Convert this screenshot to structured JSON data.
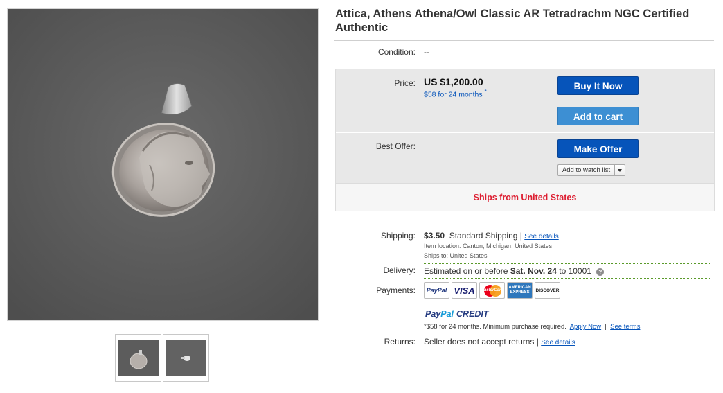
{
  "title": "Attica, Athens Athena/Owl Classic AR Tetradrachm NGC Certified Authentic",
  "condition": {
    "label": "Condition:",
    "value": "--"
  },
  "price": {
    "label": "Price:",
    "amount": "US $1,200.00",
    "financing": "$58 for 24 months",
    "financing_mark": "*"
  },
  "buttons": {
    "buy_now": "Buy It Now",
    "add_to_cart": "Add to cart",
    "make_offer": "Make Offer",
    "watch_list": "Add to watch list"
  },
  "best_offer": {
    "label": "Best Offer:"
  },
  "ships_from": "Ships from United States",
  "shipping": {
    "label": "Shipping:",
    "cost": "$3.50",
    "method": "Standard Shipping |",
    "details_link": "See details",
    "item_location": "Item location:  Canton, Michigan, United States",
    "ships_to": "Ships to:  United States"
  },
  "delivery": {
    "label": "Delivery:",
    "prefix": "Estimated on or before",
    "date": "Sat. Nov. 24",
    "suffix": "to 10001"
  },
  "payments": {
    "label": "Payments:",
    "logos": [
      "PayPal",
      "VISA",
      "MasterCard",
      "AMERICAN EXPRESS",
      "DISCOVER"
    ],
    "paypal_credit": [
      "Pay",
      "Pal",
      "CREDIT"
    ],
    "credit_note": "*$58 for 24 months. Minimum purchase required.",
    "apply_now": "Apply Now",
    "see_terms": "See terms",
    "separator": "|"
  },
  "returns": {
    "label": "Returns:",
    "value": "Seller does not accept returns |",
    "details_link": "See details"
  },
  "icons": {
    "help": "question-circle-icon",
    "dropdown": "chevron-down-icon"
  },
  "colors": {
    "primary_button": "#0654ba",
    "cart_button": "#3d8fd3",
    "ships_text": "#dd1e31",
    "link": "#0654ba"
  }
}
